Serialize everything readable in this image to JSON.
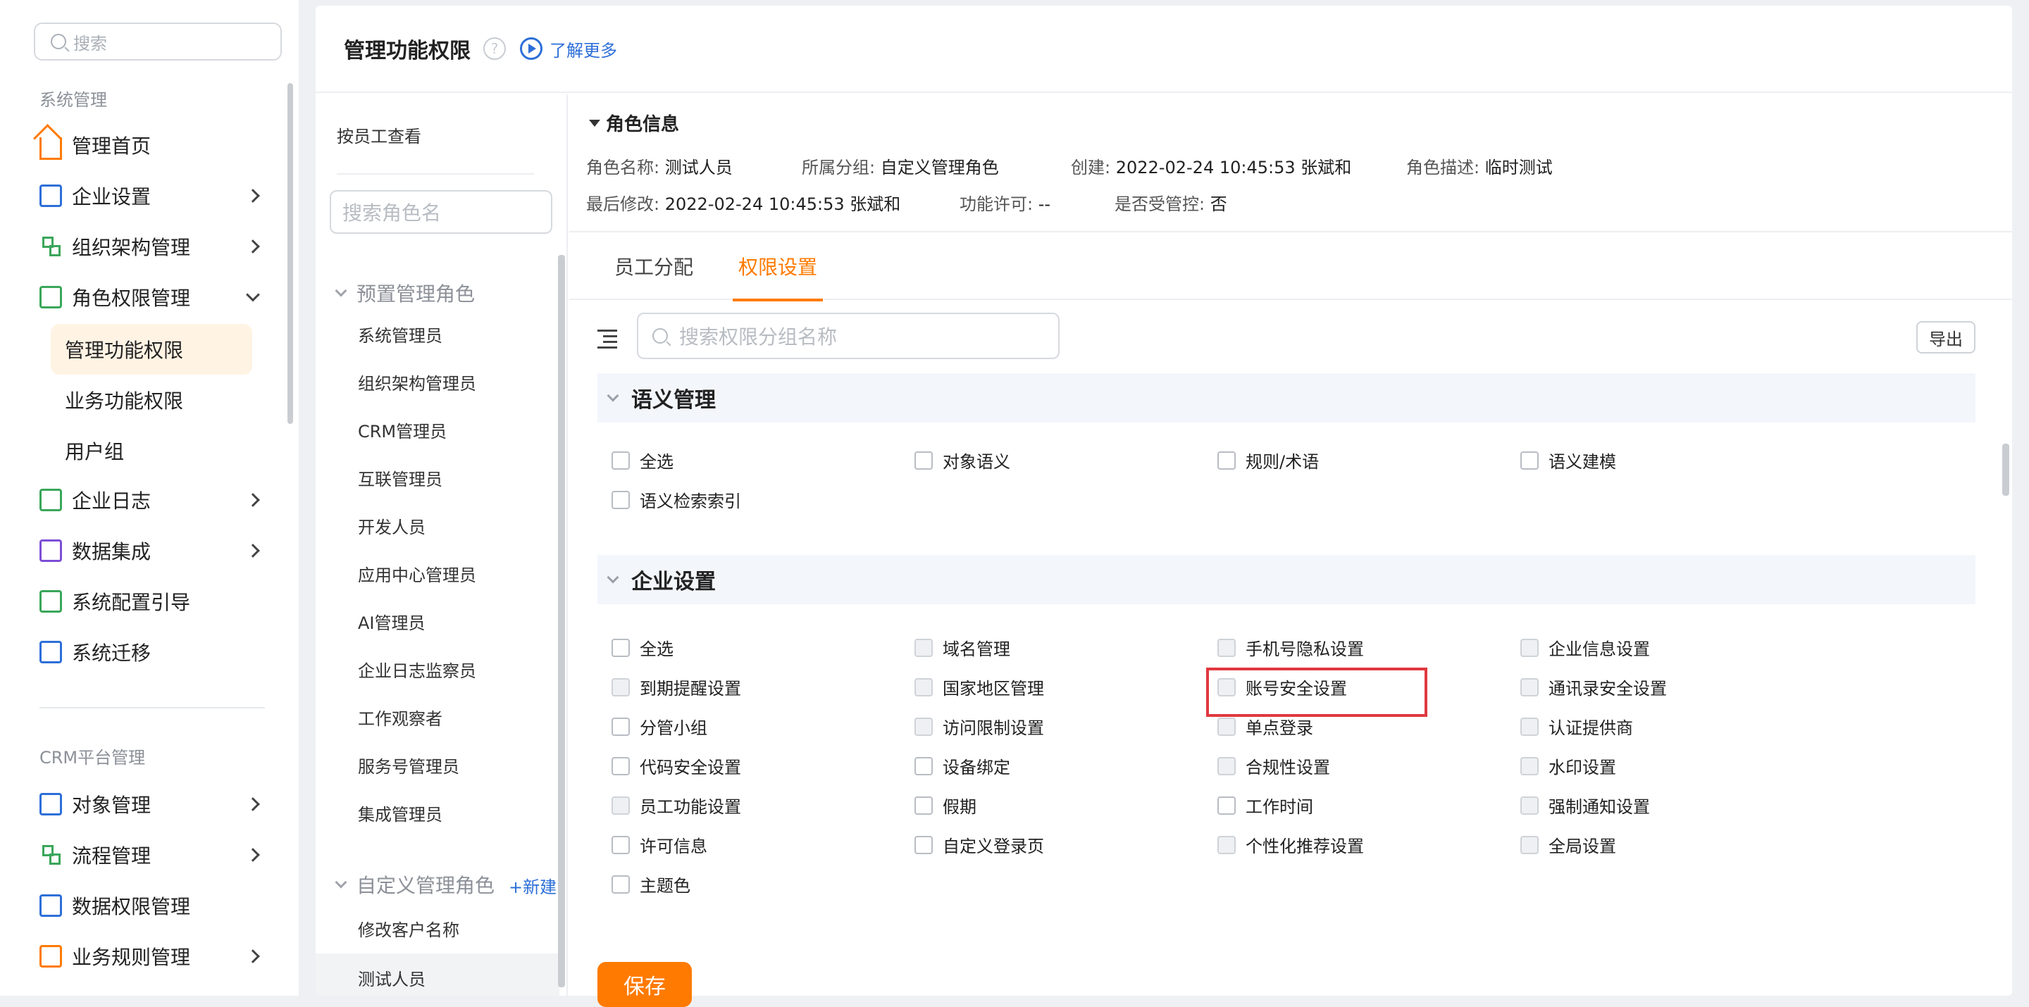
{
  "sidebar": {
    "search_placeholder": "搜索",
    "group1": "系统管理",
    "items": [
      {
        "label": "管理首页"
      },
      {
        "label": "企业设置"
      },
      {
        "label": "组织架构管理"
      },
      {
        "label": "角色权限管理"
      }
    ],
    "sub_items": [
      {
        "label": "管理功能权限"
      },
      {
        "label": "业务功能权限"
      },
      {
        "label": "用户组"
      }
    ],
    "items2": [
      {
        "label": "企业日志"
      },
      {
        "label": "数据集成"
      },
      {
        "label": "系统配置引导"
      },
      {
        "label": "系统迁移"
      }
    ],
    "group2": "CRM平台管理",
    "items3": [
      {
        "label": "对象管理"
      },
      {
        "label": "流程管理"
      },
      {
        "label": "数据权限管理"
      },
      {
        "label": "业务规则管理"
      }
    ]
  },
  "header": {
    "title": "管理功能权限",
    "help": "?",
    "learn_more": "了解更多"
  },
  "roles": {
    "by_employee": "按员工查看",
    "search_placeholder": "搜索角色名",
    "preset_group": "预置管理角色",
    "preset": [
      "系统管理员",
      "组织架构管理员",
      "CRM管理员",
      "互联管理员",
      "开发人员",
      "应用中心管理员",
      "AI管理员",
      "企业日志监察员",
      "工作观察者",
      "服务号管理员",
      "集成管理员"
    ],
    "custom_group": "自定义管理角色",
    "new_label": "+新建",
    "custom": [
      "修改客户名称",
      "测试人员"
    ]
  },
  "info": {
    "title": "角色信息",
    "name_k": "角色名称:",
    "name_v": "测试人员",
    "group_k": "所属分组:",
    "group_v": "自定义管理角色",
    "created_k": "创建:",
    "created_v": "2022-02-24 10:45:53 张斌和",
    "desc_k": "角色描述:",
    "desc_v": "临时测试",
    "modified_k": "最后修改:",
    "modified_v": "2022-02-24 10:45:53 张斌和",
    "license_k": "功能许可:",
    "license_v": "--",
    "controlled_k": "是否受管控:",
    "controlled_v": "否"
  },
  "tabs": [
    {
      "label": "员工分配"
    },
    {
      "label": "权限设置"
    }
  ],
  "perm": {
    "search_placeholder": "搜索权限分组名称",
    "export": "导出",
    "save": "保存"
  },
  "sections": [
    {
      "title": "语义管理",
      "items": [
        "全选",
        "对象语义",
        "规则/术语",
        "语义建模",
        "语义检索索引"
      ]
    },
    {
      "title": "企业设置",
      "items": [
        "全选",
        "域名管理",
        "手机号隐私设置",
        "企业信息设置",
        "到期提醒设置",
        "国家地区管理",
        "账号安全设置",
        "通讯录安全设置",
        "分管小组",
        "访问限制设置",
        "单点登录",
        "认证提供商",
        "代码安全设置",
        "设备绑定",
        "合规性设置",
        "水印设置",
        "员工功能设置",
        "假期",
        "工作时间",
        "强制通知设置",
        "许可信息",
        "自定义登录页",
        "个性化推荐设置",
        "全局设置",
        "主题色"
      ]
    }
  ],
  "colors": {
    "accent": "#ff7a00",
    "link": "#2d6fd8",
    "highlight": "#e0383e"
  }
}
